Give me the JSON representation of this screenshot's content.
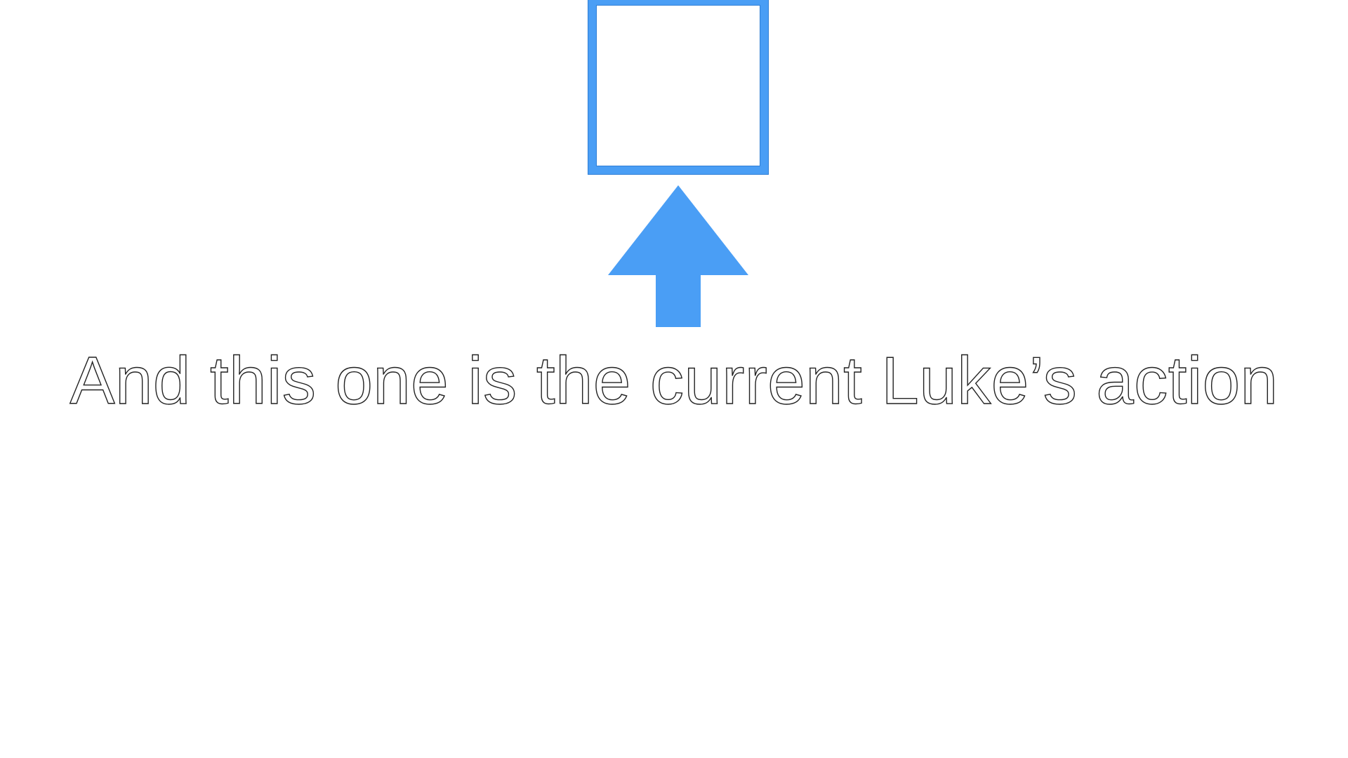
{
  "caption": {
    "text": "And this one is the current Luke’s action"
  },
  "colors": {
    "accent": "#4a9ef5",
    "text_fill": "#ffffff",
    "text_outline": "#222222"
  },
  "icons": {
    "box": "square-frame-icon",
    "arrow": "arrow-up-icon"
  }
}
